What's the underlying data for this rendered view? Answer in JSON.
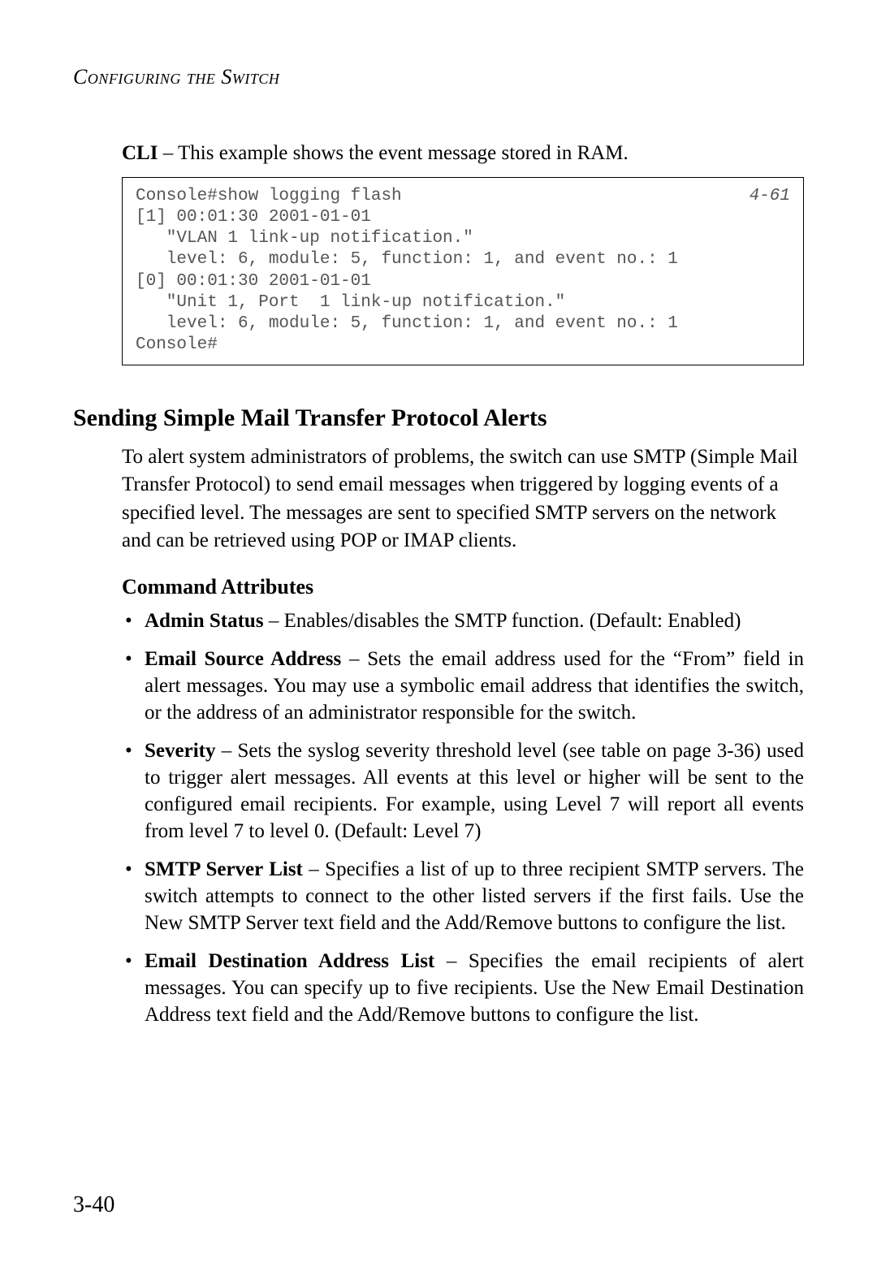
{
  "running_head": "Configuring the Switch",
  "cli_intro_prefix": "CLI",
  "cli_intro_rest": " – This example shows the event message stored in RAM.",
  "console_ref": "4-61",
  "console_text": "Console#show logging flash\n[1] 00:01:30 2001-01-01\n   \"VLAN 1 link-up notification.\"\n   level: 6, module: 5, function: 1, and event no.: 1\n[0] 00:01:30 2001-01-01\n   \"Unit 1, Port  1 link-up notification.\"\n   level: 6, module: 5, function: 1, and event no.: 1\nConsole#",
  "section_heading": "Sending Simple Mail Transfer Protocol Alerts",
  "section_para": "To alert system administrators of problems, the switch can use SMTP (Simple Mail Transfer Protocol) to send email messages when triggered by logging events of a specified level. The messages are sent to specified SMTP servers on the network and can be retrieved using POP or IMAP clients.",
  "subheading": "Command Attributes",
  "attrs": [
    {
      "name": "Admin Status",
      "desc": " – Enables/disables the SMTP function. (Default: Enabled)"
    },
    {
      "name": "Email Source Address",
      "desc": " – Sets the email address used for the “From” field in alert messages. You may use a symbolic email address that identifies the switch, or the address of an administrator responsible for the switch."
    },
    {
      "name": "Severity",
      "desc": " – Sets the syslog severity threshold level (see table on page 3-36) used to trigger alert messages. All events at this level or higher will be sent to the configured email recipients. For example, using Level 7 will report all events from level 7 to level 0. (Default: Level 7)"
    },
    {
      "name": "SMTP Server List",
      "desc": " – Specifies a list of up to three recipient SMTP servers. The switch attempts to connect to the other listed servers if the first fails. Use the New SMTP Server text field and the Add/Remove buttons to configure the list."
    },
    {
      "name": "Email Destination Address List",
      "desc": " – Specifies the email recipients of alert messages. You can specify up to five recipients. Use the New Email Destination Address text field and the Add/Remove buttons to configure the list."
    }
  ],
  "page_number": "3-40"
}
